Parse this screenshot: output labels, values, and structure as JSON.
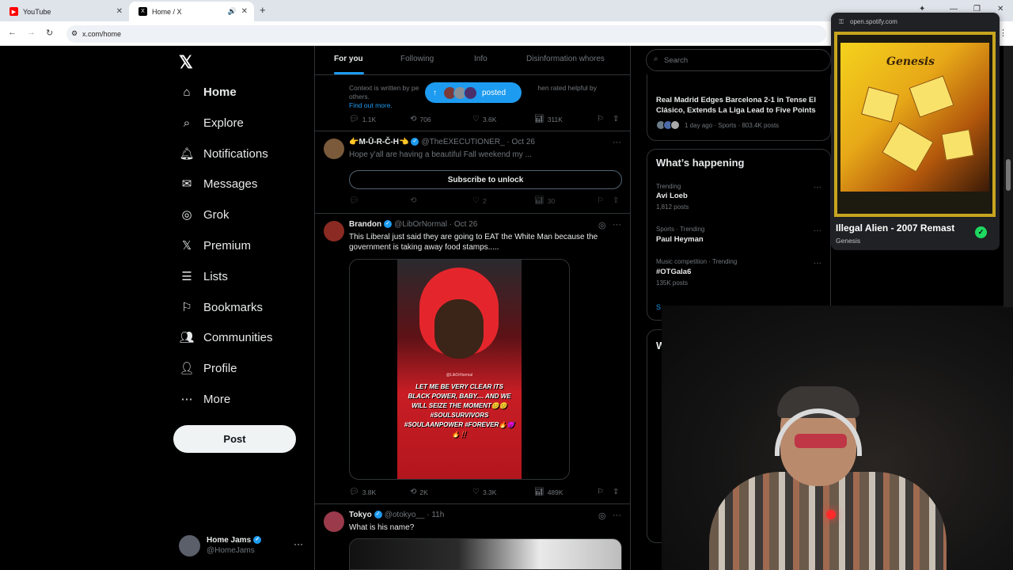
{
  "browser": {
    "tabs": [
      {
        "title": "YouTube",
        "icon": "youtube-icon"
      },
      {
        "title": "Home / X",
        "icon": "x-logo-icon"
      }
    ],
    "url": "x.com/home"
  },
  "sidebar": {
    "items": [
      {
        "label": "Home",
        "icon": "home-icon"
      },
      {
        "label": "Explore",
        "icon": "search-icon"
      },
      {
        "label": "Notifications",
        "icon": "bell-icon"
      },
      {
        "label": "Messages",
        "icon": "mail-icon"
      },
      {
        "label": "Grok",
        "icon": "grok-icon"
      },
      {
        "label": "Premium",
        "icon": "x-logo-icon"
      },
      {
        "label": "Lists",
        "icon": "list-icon"
      },
      {
        "label": "Bookmarks",
        "icon": "bookmark-icon"
      },
      {
        "label": "Communities",
        "icon": "people-icon"
      },
      {
        "label": "Profile",
        "icon": "person-icon"
      },
      {
        "label": "More",
        "icon": "more-circle-icon"
      }
    ],
    "post_label": "Post",
    "account": {
      "name": "Home Jams",
      "handle": "@HomeJams"
    }
  },
  "feed": {
    "tabs": [
      "For you",
      "Following",
      "Info",
      "Disinformation whores"
    ],
    "context_note": "Context is written by people who use X, and notes are shown when rated helpful by others.",
    "context_text_visible_left": "Context is written by pe",
    "context_text_visible_right": "hen rated helpful by others.",
    "find_out_more": "Find out more.",
    "posted_pill": "posted",
    "first_actions": {
      "replies": "1.1K",
      "reposts": "706",
      "likes": "3.6K",
      "views": "311K"
    },
    "tweets": [
      {
        "name": "👉M-Ū-R-Č-H👈",
        "handle": "@TheEXECUTIONER_",
        "time": "Oct 26",
        "text": "Hope y'all are having a beautiful Fall weekend my ...",
        "subscribe": "Subscribe to unlock",
        "replies": "",
        "reposts": "",
        "likes": "2",
        "views": "30"
      },
      {
        "name": "Brandon",
        "handle": "@LibOrNormal",
        "time": "Oct 26",
        "text": "This Liberal just said they are going to EAT the White Man because the government is taking away food stamps.....",
        "caption": "LET ME BE VERY CLEAR ITS BLACK POWER, BABY.... AND WE WILL SEIZE THE MOMENT😊😊 #SOULSURVIVORS #SOULAANPOWER #FOREVER🔥😈🔥‼️",
        "watermark": "@LibOrNormal",
        "replies": "3.8K",
        "reposts": "2K",
        "likes": "3.3K",
        "views": "489K"
      },
      {
        "name": "Tokyo",
        "handle": "@otokyo__",
        "time": "11h",
        "text": "What is his name?"
      }
    ]
  },
  "right": {
    "search_placeholder": "Search",
    "news_headline": "Real Madrid Edges Barcelona 2-1 in Tense El Clásico, Extends La Liga Lead to Five Points",
    "news_meta": "1 day ago · Sports · 803.4K posts",
    "whats_happening": "What’s happening",
    "trends": [
      {
        "category": "Trending",
        "name": "Avi Loeb",
        "count": "1,812 posts"
      },
      {
        "category": "Sports · Trending",
        "name": "Paul Heyman",
        "count": ""
      },
      {
        "category": "Music competition · Trending",
        "name": "#OTGala6",
        "count": "135K posts"
      }
    ],
    "show_more_partial": "S",
    "who_to_follow_partial": "W"
  },
  "spotify_popup": {
    "source": "open.spotify.com",
    "album_text": "Genesis",
    "song": "Illegal Alien - 2007 Remast",
    "artist": "Genesis"
  },
  "colors": {
    "accent": "#1d9bf0",
    "spotify_green": "#1ed760"
  }
}
